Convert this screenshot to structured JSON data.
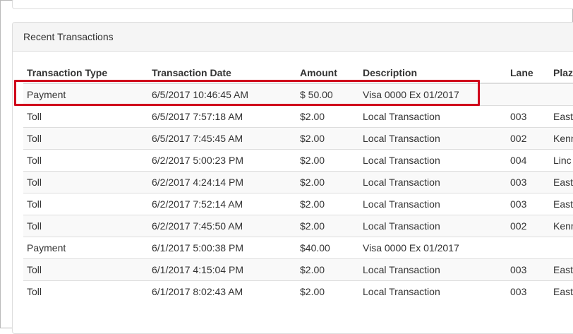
{
  "panel": {
    "title": "Recent Transactions"
  },
  "table": {
    "headers": [
      "Transaction Type",
      "Transaction Date",
      "Amount",
      "Description",
      "Lane",
      "Plaza"
    ],
    "rows": [
      [
        "Payment",
        "6/5/2017 10:46:45 AM",
        "$ 50.00",
        "Visa 0000 Ex 01/2017",
        "",
        ""
      ],
      [
        "Toll",
        "6/5/2017 7:57:18 AM",
        "$2.00",
        "Local Transaction",
        "003",
        "East"
      ],
      [
        "Toll",
        "6/5/2017 7:45:45 AM",
        "$2.00",
        "Local Transaction",
        "002",
        "Kenn"
      ],
      [
        "Toll",
        "6/2/2017 5:00:23 PM",
        "$2.00",
        "Local Transaction",
        "004",
        "Linc"
      ],
      [
        "Toll",
        "6/2/2017 4:24:14 PM",
        "$2.00",
        "Local Transaction",
        "003",
        "East"
      ],
      [
        "Toll",
        "6/2/2017 7:52:14 AM",
        "$2.00",
        "Local Transaction",
        "003",
        "East"
      ],
      [
        "Toll",
        "6/2/2017 7:45:50 AM",
        "$2.00",
        "Local Transaction",
        "002",
        "Kenn"
      ],
      [
        "Payment",
        "6/1/2017 5:00:38 PM",
        "$40.00",
        "Visa 0000 Ex 01/2017",
        "",
        ""
      ],
      [
        "Toll",
        "6/1/2017 4:15:04 PM",
        "$2.00",
        "Local Transaction",
        "003",
        "East"
      ],
      [
        "Toll",
        "6/1/2017 8:02:43 AM",
        "$2.00",
        "Local Transaction",
        "003",
        "East"
      ]
    ]
  },
  "highlight": {
    "color": "#d0021b"
  }
}
